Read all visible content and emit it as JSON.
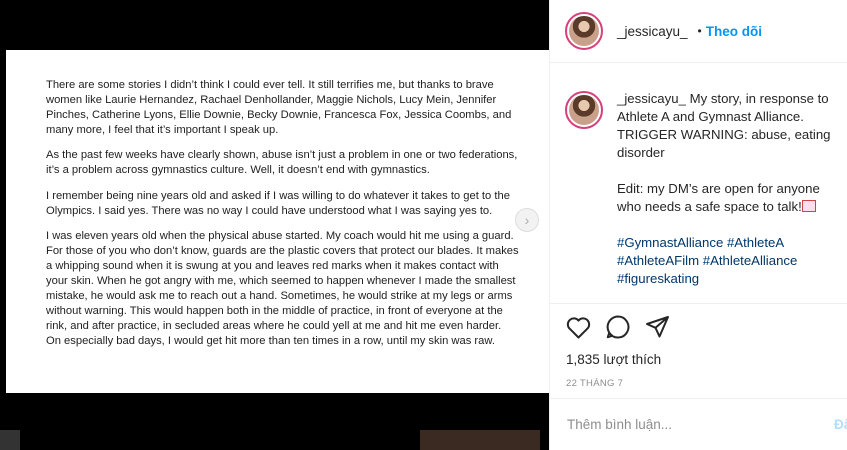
{
  "document": {
    "paragraphs": [
      "There are some stories I didn’t think I could ever tell. It still terrifies me, but thanks to brave women like Laurie Hernandez, Rachael Denhollander, Maggie Nichols, Lucy Mein, Jennifer Pinches, Catherine Lyons, Ellie Downie, Becky Downie, Francesca Fox, Jessica Coombs, and many more, I feel that it’s important I speak up.",
      "As the past few weeks have clearly shown, abuse isn’t just a problem in one or two federations, it’s a problem across gymnastics culture. Well, it doesn’t end with gymnastics.",
      "I remember being nine years old and asked if I was willing to do whatever it takes to get to the Olympics. I said yes. There was no way I could have understood what I was saying yes to.",
      "I was eleven years old when the physical abuse started. My coach would hit me using a guard. For those of you who don’t know, guards are the plastic covers that protect our blades. It makes a whipping sound when it is swung at you and leaves red marks when it makes contact with your skin. When he got angry with me, which seemed to happen whenever I made the smallest mistake, he would ask me to reach out a hand. Sometimes, he would strike at my legs or arms without warning. This would happen both in the middle of practice, in front of everyone at the rink, and after practice, in secluded areas where he could yell at me and hit me even harder. On especially bad days, I would get hit more than ten times in a row, until my skin was raw."
    ],
    "next_icon": "chevron-right-icon"
  },
  "header": {
    "username": "_jessicayu_",
    "separator": "•",
    "follow_label": "Theo dõi"
  },
  "caption": {
    "username": "_jessicayu_",
    "body": "My story, in response to Athlete A and Gymnast Alliance. TRIGGER WARNING: abuse, eating disorder",
    "edit": "Edit: my DM’s are open for anyone who needs a safe space to talk!",
    "hashtags": [
      "#GymnastAlliance",
      "#AthleteA",
      "#AthleteAFilm",
      "#AthleteAlliance",
      "#figureskating"
    ]
  },
  "actions": {
    "icons": [
      "heart-icon",
      "comment-icon",
      "share-icon"
    ],
    "likes": "1,835 lượt thích",
    "date": "22 THÁNG 7"
  },
  "comment": {
    "placeholder": "Thêm bình luận...",
    "post_label": "Đăng"
  },
  "colors": {
    "accent": "#0095f6",
    "hashtag": "#00376b",
    "story_ring": "#d93f7a"
  }
}
